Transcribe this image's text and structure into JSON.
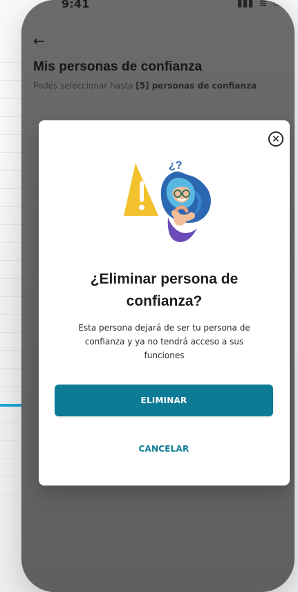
{
  "status_bar": {
    "time": "9:41",
    "icons": [
      "signal-icon",
      "wifi-icon",
      "battery-icon"
    ]
  },
  "header": {
    "back_icon": "back-arrow-icon",
    "title": "Mis personas de confianza",
    "subtitle_prefix": "Podés seleccionar hasta ",
    "subtitle_strong": "[5] personas de confianza"
  },
  "modal": {
    "close_icon": "close-icon",
    "title": "¿Eliminar persona de confianza?",
    "body": "Esta persona dejará de ser tu persona de confianza y ya no tendrá acceso a sus funciones",
    "primary_label": "ELIMINAR",
    "secondary_label": "CANCELAR"
  },
  "colors": {
    "primary": "#0d7b95",
    "pointer": "#1aa6d8",
    "overlay": "#646566",
    "modal_bg": "#ffffff"
  }
}
